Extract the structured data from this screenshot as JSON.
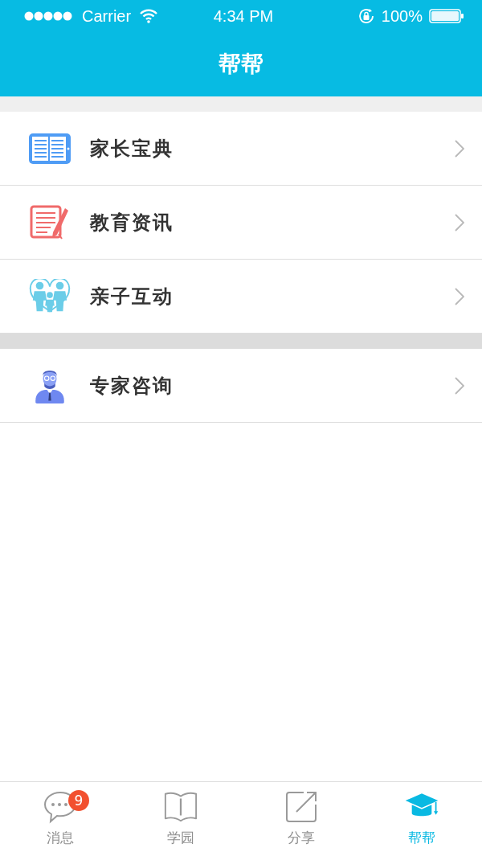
{
  "status_bar": {
    "carrier": "Carrier",
    "time": "4:34 PM",
    "battery": "100%"
  },
  "nav_bar": {
    "title": "帮帮"
  },
  "sections": [
    {
      "items": [
        {
          "label": "家长宝典"
        },
        {
          "label": "教育资讯"
        },
        {
          "label": "亲子互动"
        }
      ]
    },
    {
      "items": [
        {
          "label": "专家咨询"
        }
      ]
    }
  ],
  "tab_bar": [
    {
      "label": "消息",
      "badge": "9",
      "selected": false
    },
    {
      "label": "学园",
      "selected": false
    },
    {
      "label": "分享",
      "selected": false
    },
    {
      "label": "帮帮",
      "selected": true
    }
  ]
}
